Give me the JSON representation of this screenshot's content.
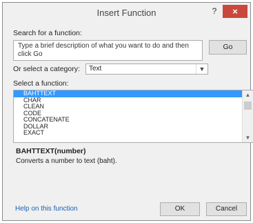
{
  "dialog": {
    "title": "Insert Function",
    "help_label": "?",
    "close_label": "×"
  },
  "search": {
    "label": "Search for a function:",
    "value": "Type a brief description of what you want to do and then click Go",
    "go_label": "Go"
  },
  "category": {
    "label": "Or select a category:",
    "selected": "Text"
  },
  "functions": {
    "label": "Select a function:",
    "items": [
      "BAHTTEXT",
      "CHAR",
      "CLEAN",
      "CODE",
      "CONCATENATE",
      "DOLLAR",
      "EXACT"
    ],
    "selected_index": 0
  },
  "detail": {
    "signature": "BAHTTEXT(number)",
    "description": "Converts a number to text (baht)."
  },
  "footer": {
    "help_link": "Help on this function",
    "ok_label": "OK",
    "cancel_label": "Cancel"
  }
}
